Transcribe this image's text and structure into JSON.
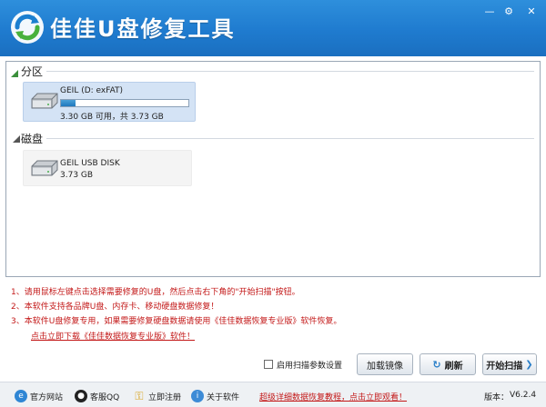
{
  "window": {
    "title": "佳佳U盘修复工具",
    "controls": {
      "minimize": "—",
      "settings": "⚙",
      "close": "✕"
    }
  },
  "partition_section": {
    "label": "分区",
    "device": {
      "name": "GEIL (D: exFAT)",
      "size_text": "3.30 GB 可用，共 3.73 GB",
      "used_fraction": 0.115
    }
  },
  "disk_section": {
    "label": "磁盘",
    "device": {
      "name": "GEIL USB DISK",
      "size_text": "3.73 GB"
    }
  },
  "tips": [
    "1、请用鼠标左键点击选择需要修复的U盘，然后点击右下角的\"开始扫描\"按钮。",
    "2、本软件支持各品牌U盘、内存卡、移动硬盘数据修复！",
    "3、本软件U盘修复专用，如果需要修复硬盘数据请使用《佳佳数据恢复专业版》软件恢复。"
  ],
  "tip_link": "点击立即下载《佳佳数据恢复专业版》软件！",
  "controls": {
    "scan_params_label": "启用扫描参数设置",
    "load_mirror_label": "加载镜像",
    "refresh_label": "刷新",
    "start_scan_label": "开始扫描"
  },
  "footer": {
    "official_site": "官方网站",
    "service_qq": "客服QQ",
    "register": "立即注册",
    "about": "关于软件",
    "promo": "超级详细数据恢复教程，点击立即观看！",
    "version_label": "版本：",
    "version": "V6.2.4"
  },
  "colors": {
    "header": "#1f7bcf",
    "tip_red": "#c31818",
    "selected_card": "#d4e3f5"
  }
}
